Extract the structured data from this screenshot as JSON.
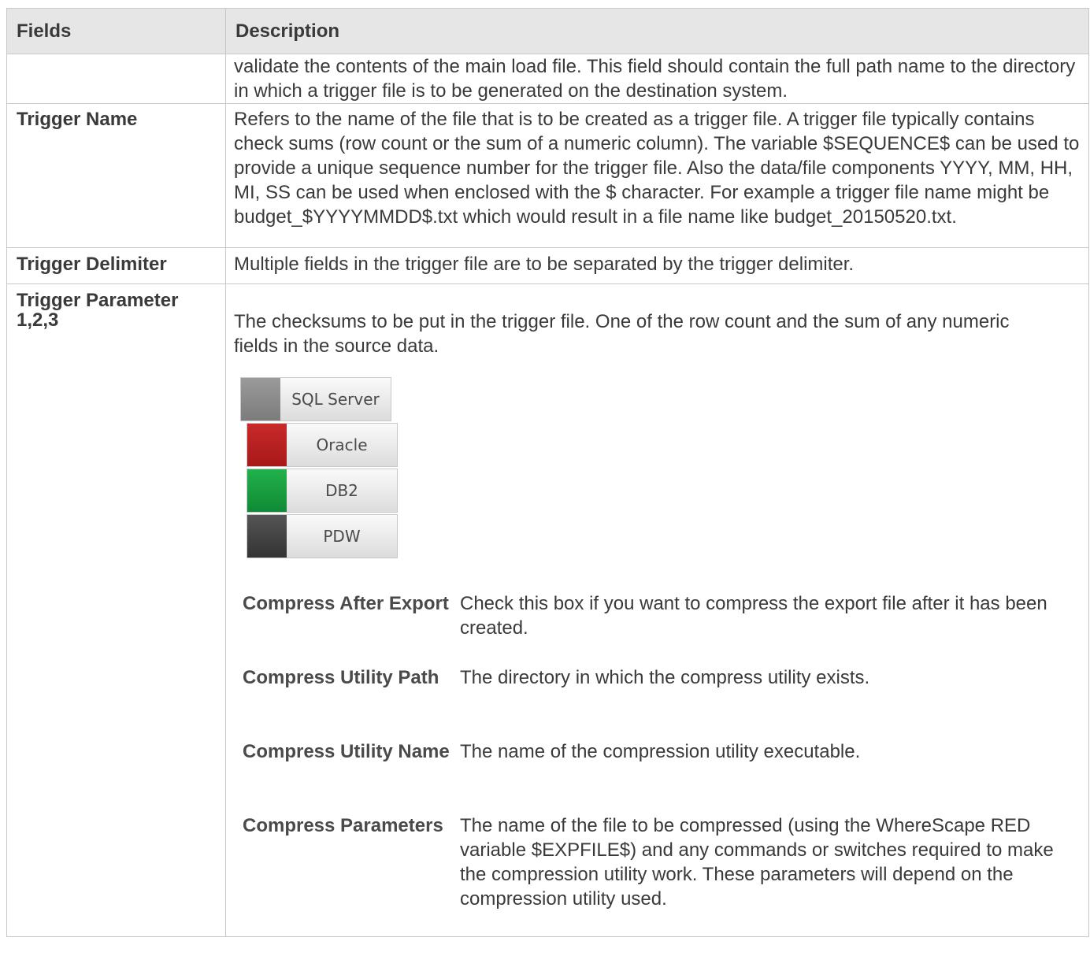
{
  "table": {
    "headers": {
      "fields": "Fields",
      "description": "Description"
    },
    "rows": [
      {
        "field": "",
        "description": "validate the contents of the main load file. This field should contain the full path name to the directory in which a trigger file is to be generated on the destination system."
      },
      {
        "field": "Trigger Name",
        "description": "Refers to the name of the file that is to be created as a trigger file. A trigger file typically contains check sums (row count or the sum of a numeric column). The variable $SEQUENCE$ can be used to provide a unique sequence number for the trigger file. Also the data/file components YYYY, MM, HH, MI, SS can be used when enclosed with the $ character. For example a trigger file name might be budget_$YYYYMMDD$.txt which would result in a file name like budget_20150520.txt."
      },
      {
        "field": "Trigger Delimiter",
        "description": "Multiple fields in the trigger file are to be separated by the trigger delimiter."
      },
      {
        "field": "Trigger Parameter 1,2,3",
        "description": "The checksums to be put in the trigger file. One of the row count and the sum of any numeric fields in the source data."
      }
    ]
  },
  "platforms": [
    {
      "label": "SQL Server",
      "color": "#8a8a8a"
    },
    {
      "label": "Oracle",
      "color": "#b82020"
    },
    {
      "label": "DB2",
      "color": "#18a040"
    },
    {
      "label": "PDW",
      "color": "#444444"
    }
  ],
  "compress_options": [
    {
      "term": "Compress After Export",
      "definition": "Check this box if you want to compress the export file after it has been created."
    },
    {
      "term": "Compress Utility Path",
      "definition": "The directory in which the compress utility exists."
    },
    {
      "term": "Compress Utility Name",
      "definition": "The name of the compression utility executable."
    },
    {
      "term": "Compress Parameters",
      "definition": "The name of the file to be compressed (using the WhereScape RED variable $EXPFILE$) and any commands or switches required to make the compression utility work. These parameters will depend on the compression utility used."
    }
  ]
}
